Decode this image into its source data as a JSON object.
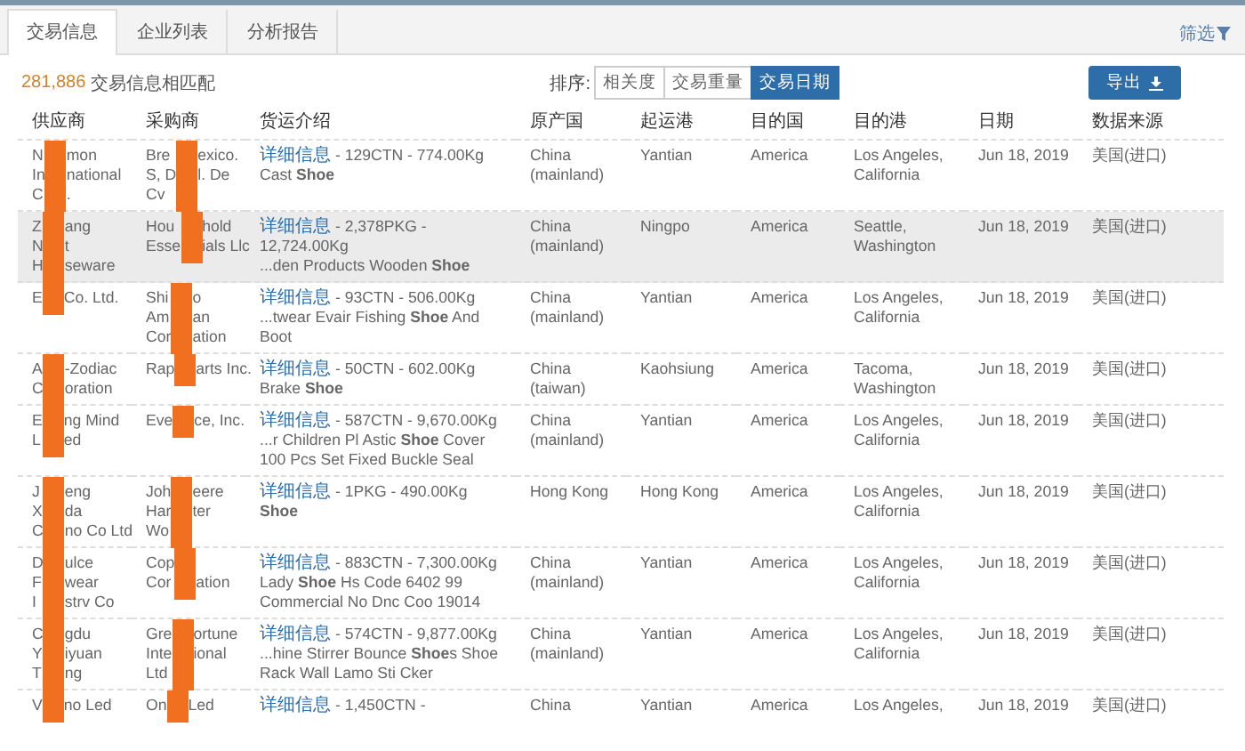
{
  "tabs": [
    {
      "label": "交易信息",
      "selected": true
    },
    {
      "label": "企业列表",
      "selected": false
    },
    {
      "label": "分析报告",
      "selected": false
    }
  ],
  "filter": {
    "label": "筛选"
  },
  "result": {
    "count": "281,886",
    "label": "交易信息相匹配"
  },
  "sort": {
    "label": "排序:",
    "options": [
      {
        "label": "相关度",
        "selected": false
      },
      {
        "label": "交易重量",
        "selected": false
      },
      {
        "label": "交易日期",
        "selected": true
      }
    ]
  },
  "export": {
    "label": "导出"
  },
  "table": {
    "columns": [
      "供应商",
      "采购商",
      "货运介绍",
      "原产国",
      "起运港",
      "目的国",
      "目的港",
      "日期",
      "数据来源"
    ],
    "rows": [
      {
        "highlighted": false,
        "supplier": [
          [
            "N",
            "mon"
          ],
          [
            "In",
            "national"
          ],
          [
            "C",
            "."
          ]
        ],
        "buyer": [
          [
            "Bre",
            "exico."
          ],
          [
            "S, D",
            "l. De"
          ],
          [
            "Cv"
          ]
        ],
        "link": "详细信息",
        "summary": " - 129CTN - 774.00Kg",
        "description": "Cast **Shoe**",
        "origin": "China (mainland)",
        "port": "Yantian",
        "country": "America",
        "destination": "Los Angeles, California",
        "date": "Jun 18, 2019",
        "source": "美国(进口)"
      },
      {
        "highlighted": true,
        "supplier": [
          [
            "Z",
            "ang"
          ],
          [
            "N",
            "t"
          ],
          [
            "H",
            "seware"
          ]
        ],
        "buyer": [
          [
            "Hou",
            "hold"
          ],
          [
            "Esse",
            "ials Llc"
          ]
        ],
        "link": "详细信息",
        "summary": " - 2,378PKG - 12,724.00Kg",
        "description": "...den Products Wooden **Shoe**",
        "origin": "China (mainland)",
        "port": "Ningpo",
        "country": "America",
        "destination": "Seattle, Washington",
        "date": "Jun 18, 2019",
        "source": "美国(进口)"
      },
      {
        "highlighted": false,
        "supplier": [
          [
            "E",
            "Co. Ltd."
          ]
        ],
        "buyer": [
          [
            "Shi",
            "o"
          ],
          [
            "Am",
            "an"
          ],
          [
            "Cor",
            "ation"
          ]
        ],
        "link": "详细信息",
        "summary": " - 93CTN - 506.00Kg",
        "description": "...twear Evair Fishing **Shoe** And Boot",
        "origin": "China (mainland)",
        "port": "Yantian",
        "country": "America",
        "destination": "Los Angeles, California",
        "date": "Jun 18, 2019",
        "source": "美国(进口)"
      },
      {
        "highlighted": false,
        "supplier": [
          [
            "A",
            "-Zodiac"
          ],
          [
            "C",
            "oration"
          ]
        ],
        "buyer": [
          [
            "Rap",
            "arts Inc."
          ]
        ],
        "link": "详细信息",
        "summary": " - 50CTN - 602.00Kg",
        "description": "Brake **Shoe**",
        "origin": "China (taiwan)",
        "port": "Kaohsiung",
        "country": "America",
        "destination": "Tacoma, Washington",
        "date": "Jun 18, 2019",
        "source": "美国(进口)"
      },
      {
        "highlighted": false,
        "supplier": [
          [
            "E",
            "ng Mind"
          ],
          [
            "L",
            "ed"
          ]
        ],
        "buyer": [
          [
            "Eve",
            "ce, Inc."
          ]
        ],
        "link": "详细信息",
        "summary": " - 587CTN - 9,670.00Kg",
        "description": "...r Children Pl Astic **Shoe** Cover 100 Pcs Set Fixed Buckle Seal",
        "origin": "China (mainland)",
        "port": "Yantian",
        "country": "America",
        "destination": "Los Angeles, California",
        "date": "Jun 18, 2019",
        "source": "美国(进口)"
      },
      {
        "highlighted": false,
        "supplier": [
          [
            "J",
            "eng"
          ],
          [
            "X",
            "da"
          ],
          [
            "C",
            "no Co Ltd"
          ]
        ],
        "buyer": [
          [
            "Joh",
            "eere"
          ],
          [
            "Har",
            "ter"
          ],
          [
            "Wo"
          ]
        ],
        "link": "详细信息",
        "summary": " - 1PKG - 490.00Kg",
        "description": "**Shoe**",
        "origin": "Hong Kong",
        "port": "Hong Kong",
        "country": "America",
        "destination": "Los Angeles, California",
        "date": "Jun 18, 2019",
        "source": "美国(进口)"
      },
      {
        "highlighted": false,
        "supplier": [
          [
            "D",
            "ulce"
          ],
          [
            "F",
            "wear"
          ],
          [
            "I",
            "strv Co"
          ]
        ],
        "buyer": [
          [
            "Cop"
          ],
          [
            "Cor",
            "ation"
          ]
        ],
        "link": "详细信息",
        "summary": " - 883CTN - 7,300.00Kg",
        "description": "Lady **Shoe** Hs Code 6402 99 Commercial No Dnc Coo 19014",
        "origin": "China (mainland)",
        "port": "Yantian",
        "country": "America",
        "destination": "Los Angeles, California",
        "date": "Jun 18, 2019",
        "source": "美国(进口)"
      },
      {
        "highlighted": false,
        "supplier": [
          [
            "C",
            "gdu"
          ],
          [
            "Y",
            "iyuan"
          ],
          [
            "T",
            "ng"
          ]
        ],
        "buyer": [
          [
            "Gre",
            "ortune"
          ],
          [
            "Inte",
            "ional"
          ],
          [
            "Ltd"
          ]
        ],
        "link": "详细信息",
        "summary": " - 574CTN - 9,877.00Kg",
        "description": "...hine Stirrer Bounce **Shoe**s Shoe Rack Wall Lamo Sti Cker",
        "origin": "China (mainland)",
        "port": "Yantian",
        "country": "America",
        "destination": "Los Angeles, California",
        "date": "Jun 18, 2019",
        "source": "美国(进口)"
      },
      {
        "highlighted": false,
        "supplier": [
          [
            "V",
            "no Led"
          ]
        ],
        "buyer": [
          [
            "On",
            "Led"
          ]
        ],
        "link": "详细信息",
        "summary": " - 1,450CTN -",
        "origin": "China",
        "port": "Yantian",
        "country": "America",
        "destination": "Los Angeles,",
        "date": "Jun 18, 2019",
        "source": "美国(进口)"
      }
    ]
  }
}
